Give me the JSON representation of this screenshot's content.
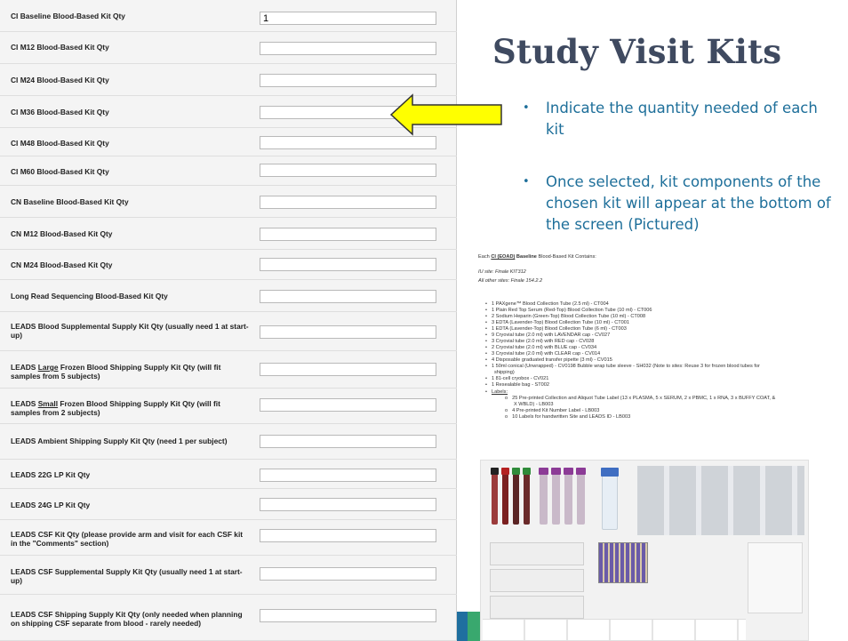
{
  "form": {
    "rows": [
      {
        "label": "CI Baseline Blood-Based Kit Qty",
        "value": "1"
      },
      {
        "label": "CI M12 Blood-Based Kit Qty",
        "value": ""
      },
      {
        "label": "CI M24 Blood-Based Kit Qty",
        "value": ""
      },
      {
        "label": "CI M36 Blood-Based Kit Qty",
        "value": ""
      },
      {
        "label": "CI M48 Blood-Based Kit Qty",
        "value": ""
      },
      {
        "label": "CI M60 Blood-Based Kit Qty",
        "value": ""
      },
      {
        "label": "CN Baseline Blood-Based Kit Qty",
        "value": ""
      },
      {
        "label": "CN M12 Blood-Based Kit Qty",
        "value": ""
      },
      {
        "label": "CN M24 Blood-Based Kit Qty",
        "value": ""
      },
      {
        "label": "Long Read Sequencing Blood-Based Kit Qty",
        "value": ""
      },
      {
        "label": "LEADS Blood Supplemental Supply Kit Qty (usually need 1 at start-up)",
        "value": ""
      },
      {
        "label_pre": "LEADS ",
        "label_ul": "Large",
        "label_post": " Frozen Blood Shipping Supply Kit Qty (will fit samples from 5 subjects)",
        "value": ""
      },
      {
        "label_pre": "LEADS ",
        "label_ul": "Small",
        "label_post": " Frozen Blood Shipping Supply Kit Qty (will fit samples from 2 subjects)",
        "value": ""
      },
      {
        "label": "LEADS Ambient Shipping Supply Kit Qty (need 1 per subject)",
        "value": ""
      },
      {
        "label": "LEADS 22G LP Kit Qty",
        "value": ""
      },
      {
        "label": "LEADS 24G LP Kit Qty",
        "value": ""
      },
      {
        "label": "LEADS CSF Kit Qty (please provide arm and visit for each CSF kit in the \"Comments\" section)",
        "value": ""
      },
      {
        "label": "LEADS CSF Supplemental Supply Kit Qty (usually need 1 at start-up)",
        "value": ""
      },
      {
        "label": "LEADS CSF Shipping Supply Kit Qty (only needed when planning on shipping CSF separate from blood - rarely needed)",
        "value": ""
      }
    ]
  },
  "slide": {
    "title": "Study Visit Kits",
    "bullets": [
      "Indicate the quantity needed of each kit",
      "Once selected, kit components of the chosen kit will appear at the bottom of the screen (Pictured)"
    ],
    "bullet_glyph": "•"
  },
  "kit": {
    "heading_pre": "Each ",
    "heading_link": "CI (EOAD)",
    "heading_bold": " Baseline",
    "heading_post": " Blood-Based Kit Contains:",
    "iu_site": "IU site: Finale KIT312",
    "other_sites": "All other sites: Finale 154.2.2",
    "items": [
      "1  PAXgene™ Blood Collection Tube (2.5 ml) - CT004",
      "1  Plain Red Top Serum (Red-Top) Blood Collection Tube (10 ml) - CT006",
      "2  Sodium Heparin (Green-Top) Blood Collection Tube (10 ml) - CT008",
      "3  EDTA (Lavender-Top) Blood Collection Tube (10 ml) - CT001",
      "1  EDTA (Lavender-Top) Blood Collection Tube (6 ml) - CT003",
      "9  Cryovial tube (2.0 ml) with LAVENDAR cap - CV027",
      "3  Cryovial tube (2.0 ml) with RED cap - CV028",
      "2  Cryovial tube (2.0 ml) with BLUE cap - CV034",
      "3  Cryovial tube (2.0 ml) with CLEAR cap - CV014",
      "4  Disposable graduated transfer pipette (3 ml) - CV015",
      "1  50ml conical (Unwrapped) - CV0198  Bubble wrap tube sleeve - SH032 (Note to sites: Reuse 3 for frozen blood tubes for",
      "shipping)",
      "1  81-cell cryobox - CV021",
      "1  Resealable bag - ST002",
      "Labels:"
    ],
    "sub_items": [
      "25  Pre-printed Collection and Aliquot Tube Label (13 x PLASMA, 5 x SERUM, 2 x PBMC, 1 x RNA, 3 x BUFFY COAT, &",
      "X WBLD) - LB003",
      "4  Pre-printed Kit Number Label - LB003",
      "10  Labels for handwritten Site and LEADS ID - LB003"
    ],
    "sub_glyph": "o"
  },
  "colors": {
    "arrow_fill": "#ffff00",
    "arrow_stroke": "#333333",
    "title": "#3f4a60",
    "bullet": "#1e6f9a"
  }
}
